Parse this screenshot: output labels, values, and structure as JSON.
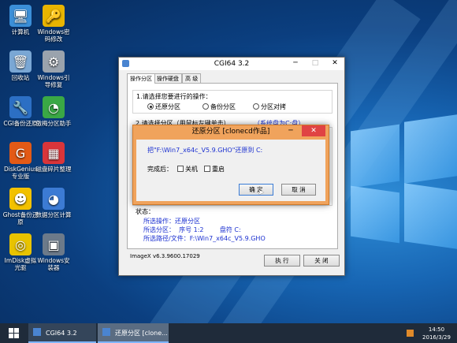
{
  "desktop": {
    "icons": [
      {
        "label": "计算机",
        "icon": "computer-icon",
        "color": "#3b8fd8"
      },
      {
        "label": "Windows密\n码修改",
        "icon": "key-icon",
        "color": "#e8b400"
      },
      {
        "label": "回收站",
        "icon": "recycle-bin-icon",
        "color": "#7aa7d4"
      },
      {
        "label": "Windows引\n导修复",
        "icon": "gear-icon",
        "color": "#9aa3ad"
      },
      {
        "label": "CGI备份还原",
        "icon": "wrench-icon",
        "color": "#2c6fc4"
      },
      {
        "label": "傲梅分区助手",
        "icon": "disk-pie-icon",
        "color": "#3aa845"
      },
      {
        "label": "DiskGenius\n专业版",
        "icon": "diskgenius-icon",
        "color": "#e35a16"
      },
      {
        "label": "磁盘碎片整理",
        "icon": "cubes-icon",
        "color": "#d9353a"
      },
      {
        "label": "Ghost备份还\n原",
        "icon": "ghost-icon",
        "color": "#f2c100"
      },
      {
        "label": "数据分区计算",
        "icon": "pie-chart-icon",
        "color": "#3c7bd4"
      },
      {
        "label": "ImDisk虚拟\n光驱",
        "icon": "cd-icon",
        "color": "#e8c300"
      },
      {
        "label": "Windows安\n装器",
        "icon": "installer-icon",
        "color": "#6c7a8a"
      }
    ]
  },
  "main_window": {
    "title": "CGI64  3.2",
    "tabs": [
      "操作分区",
      "操作硬盘",
      "高 级"
    ],
    "step1": "1.请选择您要进行的操作：",
    "options": [
      "还原分区",
      "备份分区",
      "分区对拷"
    ],
    "step2": "2.请选择分区（用鼠标左键单击）",
    "system_disk": "（系统盘为C:盘）",
    "status_label": "状态：",
    "status_lines": [
      "所选操作：还原分区",
      "所选分区：  序号 1:2        盘符 C:",
      "所选路径/文件：F:\\Win7_x64c_V5.9.GHO"
    ],
    "imagex": "ImageX v6.3.9600.17029",
    "execute": "执 行",
    "close": "关 闭"
  },
  "dialog": {
    "title": "还原分区 [clonecd作品]",
    "message": "把\"F:\\Win7_x64c_V5.9.GHO\"还原到 C:",
    "after_label": "完成后：",
    "shutdown": "关机",
    "restart": "重启",
    "ok": "确 定",
    "cancel": "取 消"
  },
  "taskbar": {
    "items": [
      "CGI64  3.2",
      "还原分区 [clone..."
    ],
    "time": "14:50",
    "date": "2016/3/29"
  }
}
